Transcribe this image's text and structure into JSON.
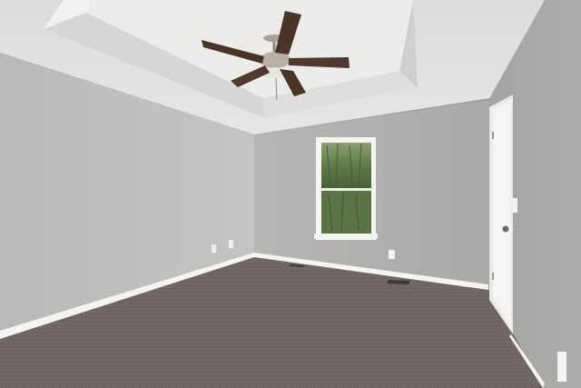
{
  "scene": {
    "subject": "empty-bedroom",
    "objects": [
      "ceiling-fan",
      "tray-ceiling",
      "window",
      "door",
      "carpet",
      "baseboards",
      "outlets",
      "floor-vents",
      "light-switch"
    ]
  },
  "colors": {
    "ceiling": "#e3e3e1",
    "tray_inner": "#e8e8e6",
    "left_wall": "#bdbdbb",
    "back_wall": "#b0b0ae",
    "right_wall": "#a8a8a6",
    "carpet": "#6f6563",
    "trim": "#f4f4f2",
    "door": "#f2f2f0",
    "window_glass": "#5e7a4a",
    "fan_blade": "#4a3428",
    "fan_metal": "#b8b0a4"
  }
}
